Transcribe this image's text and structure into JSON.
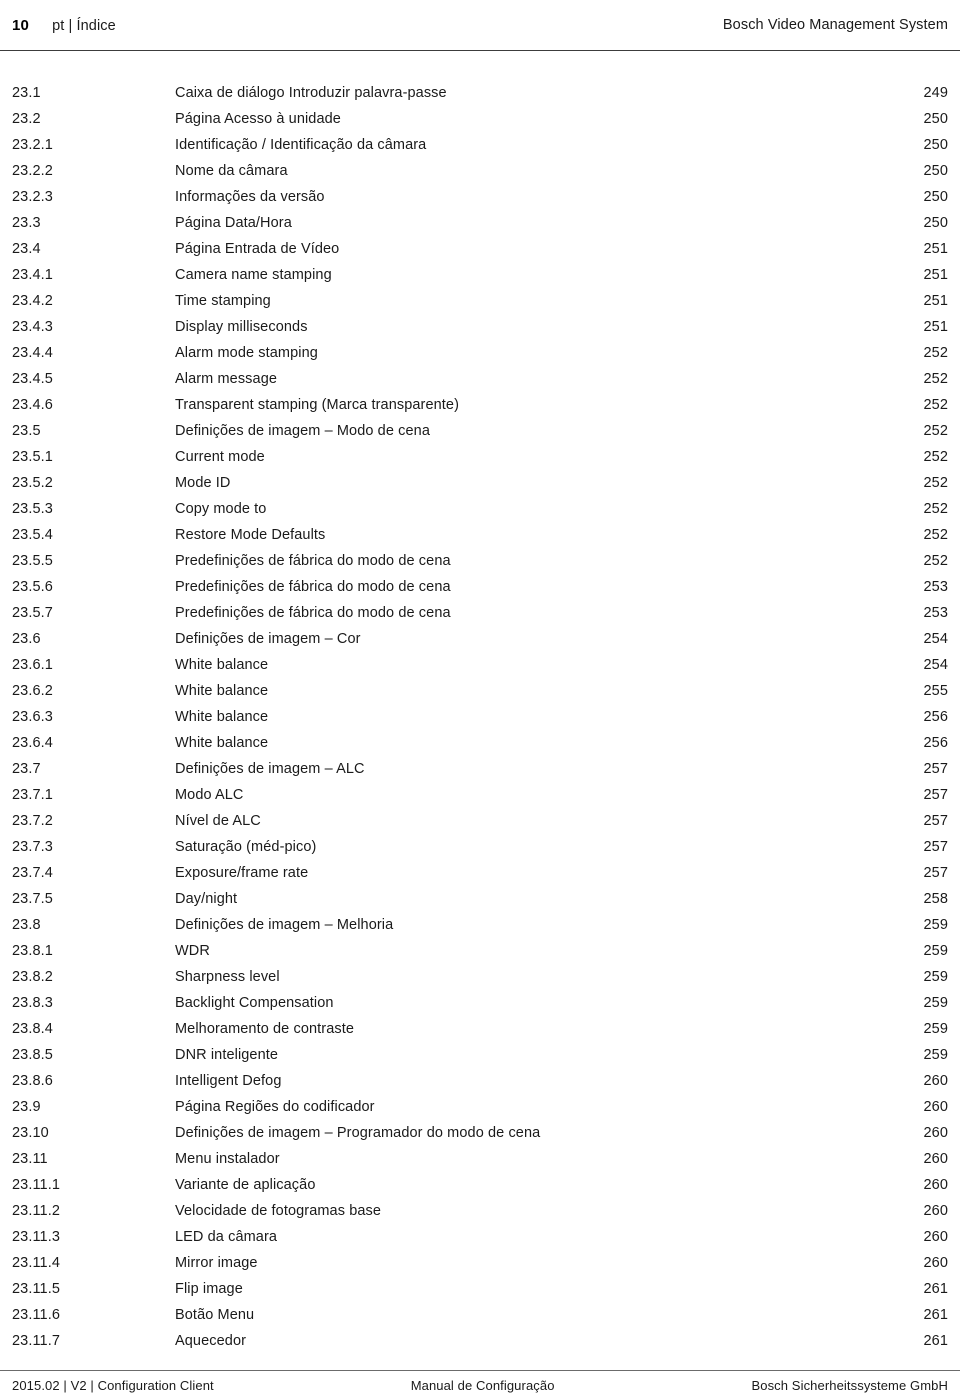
{
  "header": {
    "page_number": "10",
    "chapter": "pt | Índice",
    "product": "Bosch Video Management System"
  },
  "toc": {
    "rows": [
      {
        "num": "23.1",
        "title": "Caixa de diálogo Introduzir palavra-passe",
        "page": "249"
      },
      {
        "num": "23.2",
        "title": "Página Acesso à unidade",
        "page": "250"
      },
      {
        "num": "23.2.1",
        "title": "Identificação / Identificação da câmara",
        "page": "250"
      },
      {
        "num": "23.2.2",
        "title": "Nome da câmara",
        "page": "250"
      },
      {
        "num": "23.2.3",
        "title": "Informações da versão",
        "page": "250"
      },
      {
        "num": "23.3",
        "title": "Página Data/Hora",
        "page": "250"
      },
      {
        "num": "23.4",
        "title": "Página Entrada de Vídeo",
        "page": "251"
      },
      {
        "num": "23.4.1",
        "title": "Camera name stamping",
        "page": "251"
      },
      {
        "num": "23.4.2",
        "title": "Time stamping",
        "page": "251"
      },
      {
        "num": "23.4.3",
        "title": "Display milliseconds",
        "page": "251"
      },
      {
        "num": "23.4.4",
        "title": "Alarm mode stamping",
        "page": "252"
      },
      {
        "num": "23.4.5",
        "title": "Alarm message",
        "page": "252"
      },
      {
        "num": "23.4.6",
        "title": "Transparent stamping (Marca transparente)",
        "page": "252"
      },
      {
        "num": "23.5",
        "title": "Definições de imagem – Modo de cena",
        "page": "252"
      },
      {
        "num": "23.5.1",
        "title": "Current mode",
        "page": "252"
      },
      {
        "num": "23.5.2",
        "title": "Mode ID",
        "page": "252"
      },
      {
        "num": "23.5.3",
        "title": "Copy mode to",
        "page": "252"
      },
      {
        "num": "23.5.4",
        "title": "Restore Mode Defaults",
        "page": "252"
      },
      {
        "num": "23.5.5",
        "title": "Predefinições de fábrica do modo de cena",
        "page": "252"
      },
      {
        "num": "23.5.6",
        "title": "Predefinições de fábrica do modo de cena",
        "page": "253"
      },
      {
        "num": "23.5.7",
        "title": "Predefinições de fábrica do modo de cena",
        "page": "253"
      },
      {
        "num": "23.6",
        "title": "Definições de imagem – Cor",
        "page": "254"
      },
      {
        "num": "23.6.1",
        "title": "White balance",
        "page": "254"
      },
      {
        "num": "23.6.2",
        "title": "White balance",
        "page": "255"
      },
      {
        "num": "23.6.3",
        "title": "White balance",
        "page": "256"
      },
      {
        "num": "23.6.4",
        "title": "White balance",
        "page": "256"
      },
      {
        "num": "23.7",
        "title": "Definições de imagem – ALC",
        "page": "257"
      },
      {
        "num": "23.7.1",
        "title": "Modo ALC",
        "page": "257"
      },
      {
        "num": "23.7.2",
        "title": "Nível de ALC",
        "page": "257"
      },
      {
        "num": "23.7.3",
        "title": "Saturação (méd-pico)",
        "page": "257"
      },
      {
        "num": "23.7.4",
        "title": "Exposure/frame rate",
        "page": "257"
      },
      {
        "num": "23.7.5",
        "title": "Day/night",
        "page": "258"
      },
      {
        "num": "23.8",
        "title": "Definições de imagem – Melhoria",
        "page": "259"
      },
      {
        "num": "23.8.1",
        "title": "WDR",
        "page": "259"
      },
      {
        "num": "23.8.2",
        "title": "Sharpness level",
        "page": "259"
      },
      {
        "num": "23.8.3",
        "title": "Backlight Compensation",
        "page": "259"
      },
      {
        "num": "23.8.4",
        "title": "Melhoramento de contraste",
        "page": "259"
      },
      {
        "num": "23.8.5",
        "title": "DNR inteligente",
        "page": "259"
      },
      {
        "num": "23.8.6",
        "title": "Intelligent Defog",
        "page": "260"
      },
      {
        "num": "23.9",
        "title": "Página Regiões do codificador",
        "page": "260"
      },
      {
        "num": "23.10",
        "title": "Definições de imagem – Programador do modo de cena",
        "page": "260"
      },
      {
        "num": "23.11",
        "title": "Menu instalador",
        "page": "260"
      },
      {
        "num": "23.11.1",
        "title": "Variante de aplicação",
        "page": "260"
      },
      {
        "num": "23.11.2",
        "title": "Velocidade de fotogramas base",
        "page": "260"
      },
      {
        "num": "23.11.3",
        "title": "LED da câmara",
        "page": "260"
      },
      {
        "num": "23.11.4",
        "title": "Mirror image",
        "page": "260"
      },
      {
        "num": "23.11.5",
        "title": "Flip image",
        "page": "261"
      },
      {
        "num": "23.11.6",
        "title": "Botão Menu",
        "page": "261"
      },
      {
        "num": "23.11.7",
        "title": "Aquecedor",
        "page": "261"
      }
    ]
  },
  "footer": {
    "left": "2015.02 | V2 | Configuration Client",
    "center": "Manual de Configuração",
    "right": "Bosch Sicherheitssysteme GmbH"
  }
}
